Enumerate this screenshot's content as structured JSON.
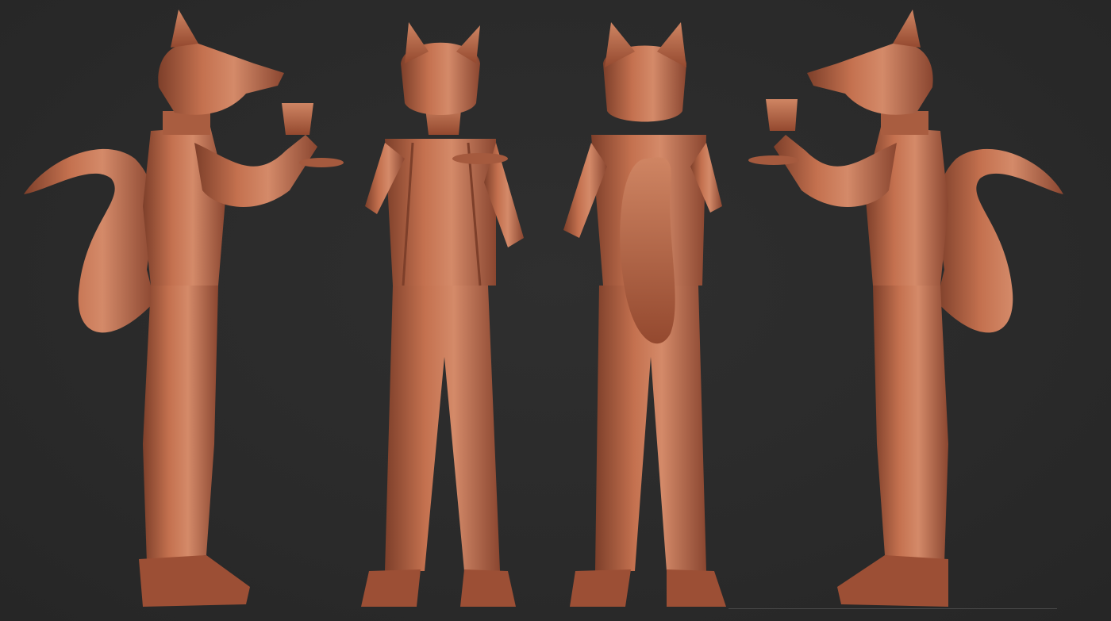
{
  "scene": {
    "background_color": "#2b2b2b",
    "clay_color": "#b8674a",
    "clay_light": "#d48a69",
    "clay_dark": "#7d3f2a",
    "views": [
      {
        "name": "side-view-left-facing-right"
      },
      {
        "name": "front-view"
      },
      {
        "name": "back-view"
      },
      {
        "name": "side-view-right-facing-left"
      }
    ],
    "subject": "fox-character-with-teacup-sculpt"
  }
}
